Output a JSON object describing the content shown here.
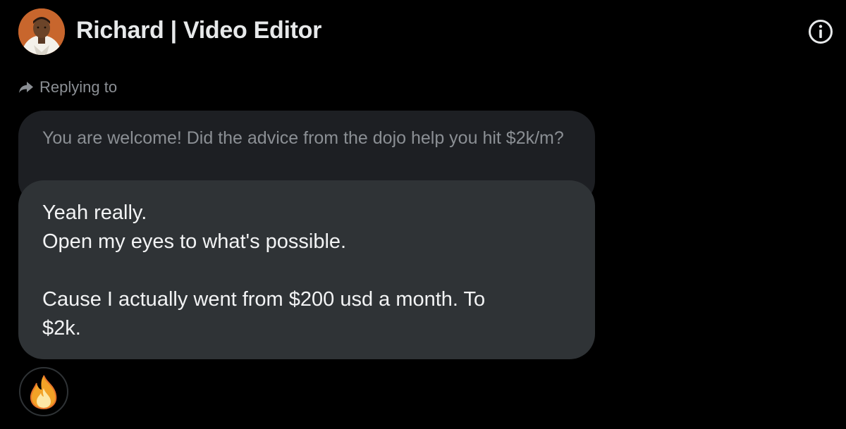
{
  "header": {
    "contact_name": "Richard | Video Editor",
    "avatar_icon": "user-avatar-photo",
    "info_icon": "info-icon"
  },
  "reply": {
    "label": "Replying to",
    "icon": "reply-arrow-icon",
    "quoted_text": "You are welcome! Did the advice from the dojo help you hit $2k/m?"
  },
  "message": {
    "lines": [
      "Yeah really.",
      "Open my eyes to what's possible.",
      "",
      "Cause I actually went from $200 usd a month. To",
      "$2k."
    ]
  },
  "reaction": {
    "emoji": "🔥",
    "icon": "fire-emoji-icon"
  },
  "colors": {
    "background": "#000000",
    "bubble": "#2f3336",
    "quoted_bubble": "#1d1f23",
    "muted_text": "#8b8f94",
    "text": "#e7e9ea"
  }
}
